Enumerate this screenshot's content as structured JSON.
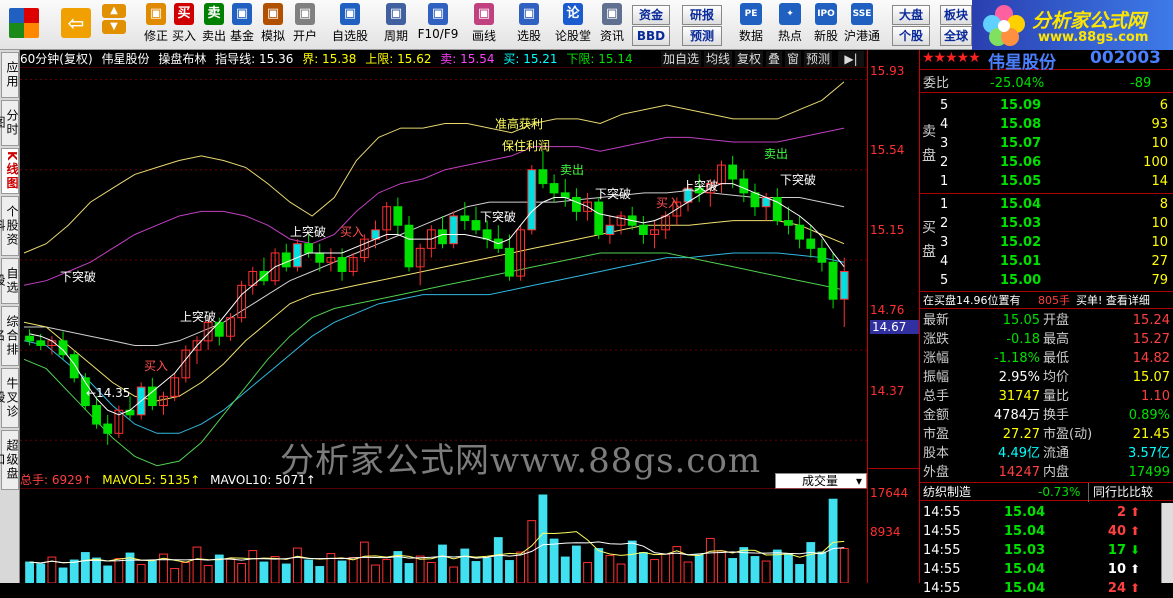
{
  "toolbar": {
    "buttons": [
      {
        "label": "修正",
        "icon": "refresh-icon",
        "color": "#e08a00"
      },
      {
        "label": "买入",
        "glyph": "买",
        "color": "#d00000"
      },
      {
        "label": "卖出",
        "glyph": "卖",
        "color": "#008000"
      },
      {
        "label": "基金",
        "icon": "fund-icon",
        "color": "#2060c0"
      },
      {
        "label": "模拟",
        "icon": "hammer-icon",
        "color": "#b05000"
      },
      {
        "label": "开户",
        "icon": "lock-icon",
        "color": "#808080"
      },
      {
        "label": "自选股",
        "icon": "star-icon",
        "color": "#2060c0"
      },
      {
        "label": "周期",
        "icon": "clock-icon",
        "color": "#4060a0"
      },
      {
        "label": "F10/F9",
        "icon": "report-icon",
        "color": "#3060c0"
      },
      {
        "label": "画线",
        "icon": "pen-icon",
        "color": "#c04080"
      },
      {
        "label": "选股",
        "icon": "screen-icon",
        "color": "#3060c0"
      },
      {
        "label": "论股堂",
        "glyph": "论",
        "color": "#1a5bd0"
      },
      {
        "label": "资讯",
        "icon": "doc-icon",
        "color": "#607090"
      }
    ],
    "small_buttons": [
      "资金",
      "研报",
      "BBD",
      "预测",
      "大盘",
      "板块",
      "个股",
      "全球"
    ],
    "labeled_icons": [
      {
        "label": "数据",
        "glyph": "PE"
      },
      {
        "label": "热点",
        "glyph": "✦"
      },
      {
        "label": "新股",
        "glyph": "IPO"
      },
      {
        "label": "沪港通",
        "glyph": "SSE"
      }
    ]
  },
  "logo": {
    "title": "分析家公式网",
    "url": "www.88gs.com"
  },
  "sidetabs": [
    "应用",
    "分时图",
    "K线图",
    "个股资料",
    "自选股",
    "综合排名",
    "牛叉诊股",
    "超级盘口"
  ],
  "active_tab": "K线图",
  "infobar": {
    "period": "60分钟(复权)",
    "stock": "伟星股份",
    "formula": "操盘布林",
    "guide": "指导线: 15.36",
    "boundary": "界: 15.38",
    "upper": "上限: 15.62",
    "sell": "卖: 15.54",
    "buy": "买: 15.21",
    "lower": "下限: 15.14",
    "buttons": [
      "加自选",
      "均线",
      "复权",
      "叠",
      "窗",
      "预测"
    ]
  },
  "price_axis": [
    "15.93",
    "15.54",
    "15.15",
    "14.76",
    "14.67",
    "14.37"
  ],
  "vol_axis": [
    "17644",
    "8934"
  ],
  "annotations": [
    "准高获利",
    "保住利润",
    "卖出",
    "买入",
    "上突破",
    "下突破",
    "←14.35"
  ],
  "volbar": {
    "total": "总手: 6929↑",
    "mavol5": "MAVOL5: 5135↑",
    "mavol10": "MAVOL10: 5071↑",
    "select": "成交量"
  },
  "watermark": "分析家公式网www.88gs.com",
  "quote": {
    "title": "伟星股份",
    "code": "002003",
    "webi_label": "委比",
    "webi": "-25.04%",
    "weicha": "-89",
    "sell_label": "卖盘",
    "buy_label": "买盘",
    "asks": [
      {
        "n": "5",
        "p": "15.09",
        "v": "6"
      },
      {
        "n": "4",
        "p": "15.08",
        "v": "93"
      },
      {
        "n": "3",
        "p": "15.07",
        "v": "10"
      },
      {
        "n": "2",
        "p": "15.06",
        "v": "100"
      },
      {
        "n": "1",
        "p": "15.05",
        "v": "14"
      }
    ],
    "bids": [
      {
        "n": "1",
        "p": "15.04",
        "v": "8"
      },
      {
        "n": "2",
        "p": "15.03",
        "v": "10"
      },
      {
        "n": "3",
        "p": "15.02",
        "v": "10"
      },
      {
        "n": "4",
        "p": "15.01",
        "v": "27"
      },
      {
        "n": "5",
        "p": "15.00",
        "v": "79"
      }
    ],
    "order_line": "在买盘14.96位置有",
    "order_qty": "805手",
    "order_right": "买单! 查看详细",
    "stats": [
      [
        "最新",
        "15.05",
        "开盘",
        "15.24"
      ],
      [
        "涨跌",
        "-0.18",
        "最高",
        "15.27"
      ],
      [
        "涨幅",
        "-1.18%",
        "最低",
        "14.82"
      ],
      [
        "振幅",
        "2.95%",
        "均价",
        "15.07"
      ],
      [
        "总手",
        "31747",
        "量比",
        "1.10"
      ],
      [
        "金额",
        "4784万",
        "换手",
        "0.89%"
      ],
      [
        "市盈",
        "27.27",
        "市盈(动)",
        "21.45"
      ],
      [
        "股本",
        "4.49亿",
        "流通",
        "3.57亿"
      ],
      [
        "外盘",
        "14247",
        "内盘",
        "17499"
      ]
    ],
    "industry": "纺织制造",
    "industry_pct": "-0.73%",
    "compare": "同行比比较",
    "ticks": [
      {
        "t": "14:55",
        "p": "15.04",
        "v": "2",
        "dir": "up"
      },
      {
        "t": "14:55",
        "p": "15.04",
        "v": "40",
        "dir": "up"
      },
      {
        "t": "14:55",
        "p": "15.03",
        "v": "17",
        "dir": "down"
      },
      {
        "t": "14:55",
        "p": "15.04",
        "v": "10",
        "dir": "up"
      },
      {
        "t": "14:55",
        "p": "15.04",
        "v": "24",
        "dir": "up"
      }
    ]
  },
  "chart_data": {
    "type": "candlestick",
    "y_range": [
      14.25,
      15.98
    ],
    "candles": [
      [
        14.82,
        14.85,
        14.78,
        14.8
      ],
      [
        14.8,
        14.83,
        14.76,
        14.78
      ],
      [
        14.78,
        14.82,
        14.74,
        14.8
      ],
      [
        14.8,
        14.84,
        14.72,
        14.74
      ],
      [
        14.74,
        14.76,
        14.62,
        14.64
      ],
      [
        14.64,
        14.66,
        14.5,
        14.52
      ],
      [
        14.52,
        14.56,
        14.42,
        14.44
      ],
      [
        14.44,
        14.48,
        14.35,
        14.4
      ],
      [
        14.4,
        14.52,
        14.38,
        14.5
      ],
      [
        14.5,
        14.56,
        14.46,
        14.48
      ],
      [
        14.48,
        14.62,
        14.46,
        14.6
      ],
      [
        14.6,
        14.64,
        14.5,
        14.52
      ],
      [
        14.52,
        14.58,
        14.48,
        14.56
      ],
      [
        14.56,
        14.66,
        14.54,
        14.64
      ],
      [
        14.64,
        14.78,
        14.62,
        14.76
      ],
      [
        14.76,
        14.82,
        14.7,
        14.8
      ],
      [
        14.8,
        14.9,
        14.76,
        14.88
      ],
      [
        14.88,
        14.9,
        14.78,
        14.82
      ],
      [
        14.82,
        14.92,
        14.8,
        14.9
      ],
      [
        14.9,
        15.06,
        14.88,
        15.04
      ],
      [
        15.04,
        15.12,
        15.0,
        15.1
      ],
      [
        15.1,
        15.16,
        15.04,
        15.06
      ],
      [
        15.06,
        15.2,
        15.04,
        15.18
      ],
      [
        15.18,
        15.22,
        15.1,
        15.12
      ],
      [
        15.12,
        15.24,
        15.1,
        15.22
      ],
      [
        15.22,
        15.26,
        15.16,
        15.18
      ],
      [
        15.18,
        15.22,
        15.1,
        15.14
      ],
      [
        15.14,
        15.2,
        15.1,
        15.16
      ],
      [
        15.16,
        15.2,
        15.06,
        15.1
      ],
      [
        15.1,
        15.18,
        15.08,
        15.16
      ],
      [
        15.16,
        15.26,
        15.14,
        15.24
      ],
      [
        15.24,
        15.32,
        15.2,
        15.28
      ],
      [
        15.28,
        15.4,
        15.24,
        15.38
      ],
      [
        15.38,
        15.42,
        15.26,
        15.3
      ],
      [
        15.3,
        15.34,
        15.1,
        15.12
      ],
      [
        15.12,
        15.22,
        15.04,
        15.2
      ],
      [
        15.2,
        15.3,
        15.16,
        15.28
      ],
      [
        15.28,
        15.34,
        15.2,
        15.22
      ],
      [
        15.22,
        15.36,
        15.2,
        15.34
      ],
      [
        15.34,
        15.4,
        15.28,
        15.32
      ],
      [
        15.32,
        15.38,
        15.26,
        15.28
      ],
      [
        15.28,
        15.32,
        15.2,
        15.24
      ],
      [
        15.24,
        15.3,
        15.18,
        15.2
      ],
      [
        15.2,
        15.26,
        15.06,
        15.08
      ],
      [
        15.08,
        15.3,
        15.06,
        15.28
      ],
      [
        15.28,
        15.56,
        15.26,
        15.54
      ],
      [
        15.54,
        15.62,
        15.46,
        15.48
      ],
      [
        15.48,
        15.52,
        15.4,
        15.44
      ],
      [
        15.44,
        15.5,
        15.38,
        15.42
      ],
      [
        15.42,
        15.46,
        15.32,
        15.36
      ],
      [
        15.36,
        15.44,
        15.32,
        15.4
      ],
      [
        15.4,
        15.42,
        15.24,
        15.26
      ],
      [
        15.26,
        15.34,
        15.22,
        15.3
      ],
      [
        15.3,
        15.36,
        15.26,
        15.34
      ],
      [
        15.34,
        15.38,
        15.28,
        15.3
      ],
      [
        15.3,
        15.34,
        15.22,
        15.26
      ],
      [
        15.26,
        15.32,
        15.2,
        15.28
      ],
      [
        15.28,
        15.36,
        15.24,
        15.34
      ],
      [
        15.34,
        15.42,
        15.3,
        15.4
      ],
      [
        15.4,
        15.48,
        15.36,
        15.46
      ],
      [
        15.46,
        15.52,
        15.4,
        15.44
      ],
      [
        15.44,
        15.5,
        15.38,
        15.48
      ],
      [
        15.48,
        15.58,
        15.44,
        15.56
      ],
      [
        15.56,
        15.6,
        15.46,
        15.5
      ],
      [
        15.5,
        15.54,
        15.4,
        15.44
      ],
      [
        15.44,
        15.48,
        15.34,
        15.38
      ],
      [
        15.38,
        15.44,
        15.32,
        15.42
      ],
      [
        15.42,
        15.46,
        15.3,
        15.32
      ],
      [
        15.32,
        15.38,
        15.26,
        15.3
      ],
      [
        15.3,
        15.34,
        15.2,
        15.24
      ],
      [
        15.24,
        15.3,
        15.16,
        15.2
      ],
      [
        15.2,
        15.24,
        15.1,
        15.14
      ],
      [
        15.14,
        15.18,
        14.94,
        14.98
      ],
      [
        14.98,
        15.16,
        14.86,
        15.1
      ]
    ],
    "bands": {
      "upper_outer": [
        15.18,
        15.22,
        15.3,
        15.4,
        15.46,
        15.52,
        15.55,
        15.58,
        15.6,
        15.58,
        15.55,
        15.48,
        15.4,
        15.34,
        15.42,
        15.58,
        15.68,
        15.72,
        15.72,
        15.74,
        15.74,
        15.72,
        15.7,
        15.74,
        15.76,
        15.76,
        15.74,
        15.78,
        15.8,
        15.82,
        15.8,
        15.78,
        15.76,
        15.76,
        15.76,
        15.8,
        15.84,
        15.92
      ],
      "upper": [
        15.04,
        15.06,
        15.1,
        15.14,
        15.2,
        15.26,
        15.3,
        15.34,
        15.36,
        15.36,
        15.34,
        15.3,
        15.24,
        15.22,
        15.26,
        15.36,
        15.44,
        15.48,
        15.5,
        15.54,
        15.56,
        15.58,
        15.6,
        15.64,
        15.64,
        15.64,
        15.62,
        15.64,
        15.66,
        15.68,
        15.68,
        15.67,
        15.66,
        15.66,
        15.66,
        15.68,
        15.7,
        15.72
      ],
      "mid": [
        14.86,
        14.86,
        14.84,
        14.82,
        14.8,
        14.78,
        14.78,
        14.8,
        14.84,
        14.88,
        14.94,
        15.0,
        15.06,
        15.1,
        15.14,
        15.18,
        15.22,
        15.26,
        15.3,
        15.34,
        15.38,
        15.4,
        15.4,
        15.4,
        15.4,
        15.41,
        15.42,
        15.43,
        15.44,
        15.44,
        15.45,
        15.44,
        15.43,
        15.42,
        15.42,
        15.42,
        15.4,
        15.38
      ],
      "lower": [
        14.88,
        14.86,
        14.78,
        14.7,
        14.62,
        14.56,
        14.54,
        14.56,
        14.62,
        14.7,
        14.8,
        14.88,
        14.96,
        15.0,
        15.02,
        15.04,
        15.06,
        15.08,
        15.1,
        15.12,
        15.14,
        15.16,
        15.18,
        15.2,
        15.22,
        15.24,
        15.26,
        15.28,
        15.3,
        15.3,
        15.3,
        15.31,
        15.32,
        15.32,
        15.32,
        15.3,
        15.26,
        15.22
      ],
      "lower_cyan": [
        14.8,
        14.78,
        14.7,
        14.62,
        14.52,
        14.44,
        14.4,
        14.4,
        14.44,
        14.5,
        14.58,
        14.66,
        14.74,
        14.82,
        14.88,
        14.92,
        14.96,
        14.98,
        15.0,
        15.0,
        15.0,
        15.0,
        15.02,
        15.04,
        15.06,
        15.08,
        15.1,
        15.12,
        15.14,
        15.16,
        15.16,
        15.17,
        15.18,
        15.18,
        15.18,
        15.17,
        15.16,
        15.14
      ],
      "lower_outer": [
        14.72,
        14.68,
        14.58,
        14.48,
        14.38,
        14.3,
        14.26,
        14.28,
        14.36,
        14.48,
        14.6,
        14.72,
        14.82,
        14.9,
        14.94,
        14.96,
        14.98,
        15.0,
        15.02,
        15.04,
        15.06,
        15.08,
        15.1,
        15.12,
        15.14,
        15.16,
        15.18,
        15.18,
        15.18,
        15.18,
        15.16,
        15.14,
        15.12,
        15.1,
        15.08,
        15.06,
        15.04,
        15.02
      ]
    },
    "volumes": [
      4200,
      3800,
      5200,
      3000,
      4600,
      6100,
      5000,
      3400,
      4900,
      6000,
      3700,
      4400,
      5800,
      2900,
      4100,
      7200,
      3500,
      5600,
      4800,
      3900,
      6500,
      4200,
      5300,
      3800,
      7000,
      4600,
      3300,
      5900,
      4400,
      5100,
      8200,
      3600,
      4700,
      6300,
      3900,
      5400,
      4100,
      7600,
      3200,
      6800,
      4300,
      5000,
      9100,
      4500,
      6200,
      12500,
      17644,
      8800,
      5200,
      7400,
      4100,
      6900,
      5500,
      3800,
      8400,
      6100,
      4700,
      5800,
      7300,
      4200,
      5600,
      8934,
      6400,
      4900,
      7100,
      5300,
      4400,
      6600,
      5900,
      3700,
      8100,
      6200,
      16800,
      6929
    ],
    "ma_price": [
      14.83,
      14.82,
      14.8,
      14.76,
      14.7,
      14.62,
      14.55,
      14.5,
      14.48,
      14.5,
      14.54,
      14.58,
      14.62,
      14.66,
      14.72,
      14.78,
      14.83,
      14.88,
      14.94,
      15.0,
      15.04,
      15.08,
      15.12,
      15.14,
      15.16,
      15.18,
      15.18,
      15.18,
      15.18,
      15.2,
      15.22,
      15.24,
      15.26,
      15.26,
      15.24,
      15.24,
      15.24,
      15.26,
      15.26,
      15.26,
      15.25,
      15.24,
      15.22,
      15.24,
      15.3,
      15.36,
      15.4,
      15.42,
      15.42,
      15.4,
      15.38,
      15.35,
      15.34,
      15.33,
      15.32,
      15.31,
      15.32,
      15.34,
      15.37,
      15.4,
      15.43,
      15.46,
      15.48,
      15.48,
      15.46,
      15.44,
      15.42,
      15.4,
      15.37,
      15.34,
      15.3,
      15.25,
      15.18,
      15.12
    ]
  }
}
